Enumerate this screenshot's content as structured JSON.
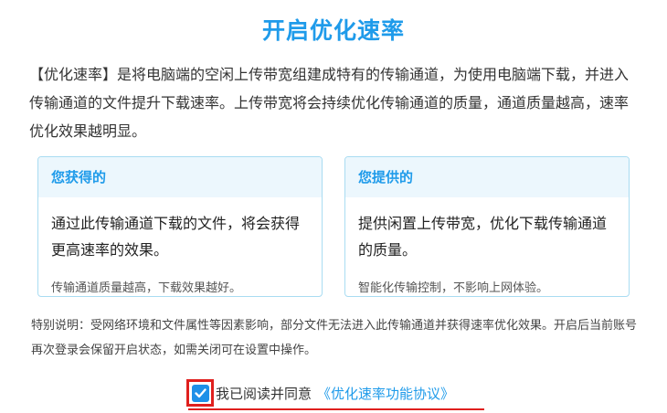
{
  "title": "开启优化速率",
  "intro": "【优化速率】是将电脑端的空闲上传带宽组建成特有的传输通道，为使用电脑端下载，并进入传输通道的文件提升下载速率。上传带宽将会持续优化传输通道的质量，通道质量越高，速率优化效果越明显。",
  "cards": {
    "gain": {
      "header": "您获得的",
      "main": "通过此传输通道下载的文件，将会获得更高速率的效果。",
      "footer": "传输通道质量越高，下载效果越好。"
    },
    "provide": {
      "header": "您提供的",
      "main": "提供闲置上传带宽，优化下载传输通道的质量。",
      "footer": "智能化传输控制，不影响上网体验。"
    }
  },
  "notice": "特别说明：受网络环境和文件属性等因素影响，部分文件无法进入此传输通道并获得速率优化效果。开启后当前账号再次登录会保留开启状态，如需关闭可在设置中操作。",
  "agreement": {
    "checked": true,
    "text": "我已阅读并同意",
    "link": "《优化速率功能协议》",
    "checkbox_icon": "check-icon"
  },
  "colors": {
    "accent": "#1f9bea",
    "highlight": "#e0201e",
    "card_border": "#a9dcf2",
    "card_header_bg": "#ecf7fd"
  }
}
